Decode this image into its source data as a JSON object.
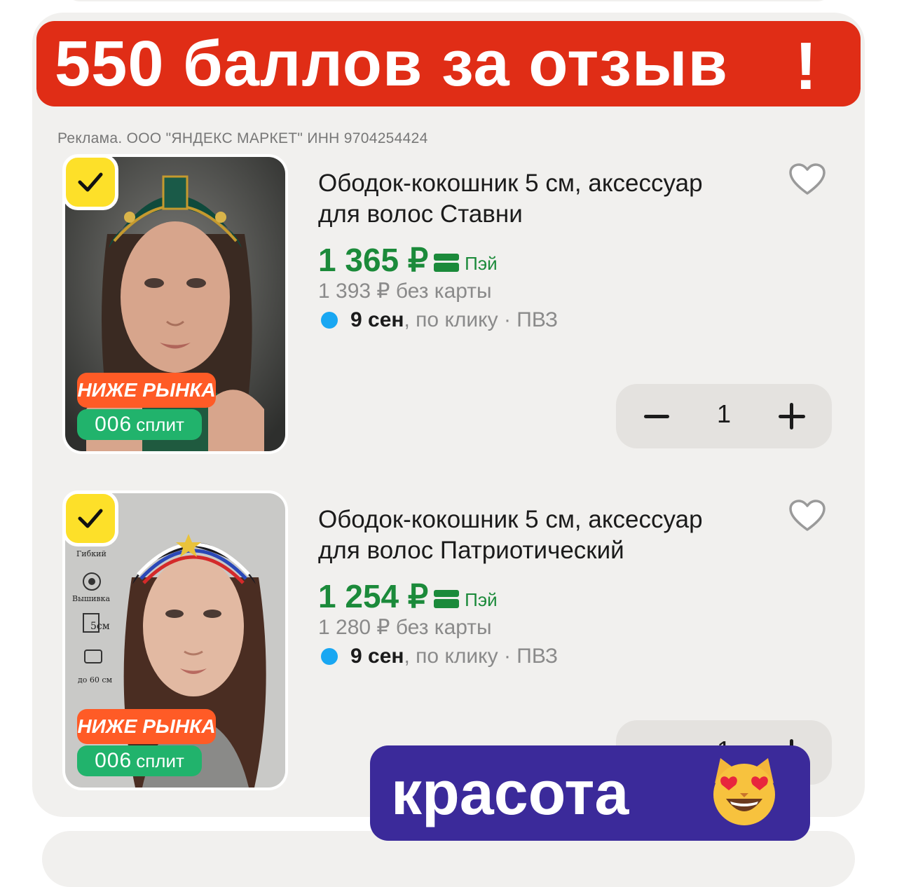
{
  "banner": {
    "text": "550 баллов за отзыв",
    "exclamation": "!"
  },
  "ad_disclaimer": "Реклама. ООО \"ЯНДЕКС МАРКЕТ\" ИНН 9704254424",
  "products": [
    {
      "title_line1": "Ободок-кокошник 5 см, аксессуар",
      "title_line2": "для волос Ставни",
      "price": "1 365 ₽",
      "pay_label": "Пэй",
      "old_price": "1 393 ₽  без карты",
      "delivery_date": "9 сен",
      "delivery_rest": ", по клику · ПВЗ",
      "badge_market": "НИЖЕ РЫНКА",
      "badge_split_num": "006",
      "badge_split_label": "сплит",
      "quantity": "1",
      "headband_color": "#0f4a3c"
    },
    {
      "title_line1": "Ободок-кокошник 5 см, аксессуар",
      "title_line2": "для волос Патриотический",
      "price": "1 254 ₽",
      "pay_label": "Пэй",
      "old_price": "1 280 ₽  без карты",
      "delivery_date": "9 сен",
      "delivery_rest": ", по клику · ПВЗ",
      "badge_market": "НИЖЕ РЫНКА",
      "badge_split_num": "006",
      "badge_split_label": "сплит",
      "quantity": "1",
      "features": [
        "Гибкий",
        "Вышивка",
        "5см",
        "до 60 см"
      ]
    }
  ],
  "sticker": {
    "text": "красота"
  },
  "colors": {
    "banner_red": "#e02d16",
    "price_green": "#1b8a3a",
    "badge_orange": "#ff5b26",
    "badge_green": "#21b36c",
    "check_yellow": "#fde029",
    "sticker_purple": "#3b2a9a",
    "delivery_dot": "#19a7f2"
  }
}
